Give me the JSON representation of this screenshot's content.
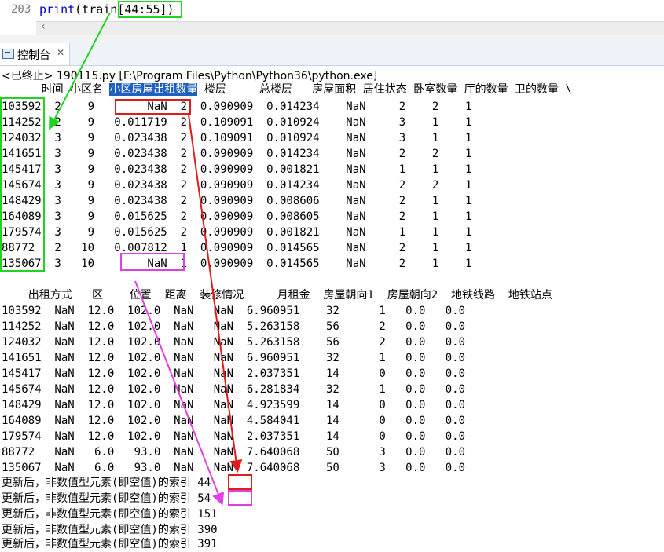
{
  "editor": {
    "line_number": "203",
    "code_prefix": "print",
    "code_rest": "(train[44:55])",
    "scroll_left_arrow": "‹"
  },
  "console": {
    "tab_label": "控制台",
    "tab_close": "✕",
    "status": "<已终止> 190115.py [F:\\Program Files\\Python\\Python36\\python.exe]"
  },
  "table1": {
    "header_a": "      时间 小区名 ",
    "header_hl": "小区房屋出租数量",
    "header_b": " 楼层     总楼层   房屋面积 居住状态 卧室数量 厅的数量 卫的数量 \\",
    "rows": [
      "103592  2    9        NaN  2  0.090909  0.014234    NaN     2    2    1",
      "114252  2    9   0.011719  2  0.109091  0.010924    NaN     3    1    1",
      "124032  3    9   0.023438  2  0.109091  0.010924    NaN     3    1    1",
      "141651  3    9   0.023438  2  0.090909  0.014234    NaN     2    2    1",
      "145417  3    9   0.023438  2  0.090909  0.001821    NaN     1    1    1",
      "145674  3    9   0.023438  2  0.090909  0.014234    NaN     2    2    1",
      "148429  3    9   0.023438  2  0.090909  0.008606    NaN     2    1    1",
      "164089  3    9   0.015625  2  0.090909  0.008605    NaN     2    1    1",
      "179574  3    9   0.015625  2  0.090909  0.001821    NaN     1    1    1",
      "88772   2   10   0.007812  1  0.090909  0.014565    NaN     2    1    1",
      "135067  3   10        NaN  1  0.090909  0.014565    NaN     2    1    1"
    ]
  },
  "table2": {
    "header": "    出租方式   区    位置  距离  装修情况     月租金  房屋朝向1  房屋朝向2  地铁线路  地铁站点",
    "rows": [
      "103592  NaN  12.0  102.0  NaN   NaN  6.960951    32      1   0.0   0.0",
      "114252  NaN  12.0  102.0  NaN   NaN  5.263158    56      2   0.0   0.0",
      "124032  NaN  12.0  102.0  NaN   NaN  5.263158    56      2   0.0   0.0",
      "141651  NaN  12.0  102.0  NaN   NaN  6.960951    32      1   0.0   0.0",
      "145417  NaN  12.0  102.0  NaN   NaN  2.037351    14      0   0.0   0.0",
      "145674  NaN  12.0  102.0  NaN   NaN  6.281834    32      1   0.0   0.0",
      "148429  NaN  12.0  102.0  NaN   NaN  4.923599    14      0   0.0   0.0",
      "164089  NaN  12.0  102.0  NaN   NaN  4.584041    14      0   0.0   0.0",
      "179574  NaN  12.0  102.0  NaN   NaN  2.037351    14      0   0.0   0.0",
      "88772   NaN   6.0   93.0  NaN   NaN  7.640068    50      3   0.0   0.0",
      "135067  NaN   6.0   93.0  NaN   NaN  7.640068    50      3   0.0   0.0"
    ]
  },
  "updates": [
    "更新后，非数值型元素(即空值)的索引 44",
    "更新后，非数值型元素(即空值)的索引 54",
    "更新后，非数值型元素(即空值)的索引 151",
    "更新后，非数值型元素(即空值)的索引 390",
    "更新后，非数值型元素(即空值)的索引 391"
  ],
  "annotation_colors": {
    "green": "#22d422",
    "red": "#e01b1b",
    "magenta": "#e040e0"
  }
}
